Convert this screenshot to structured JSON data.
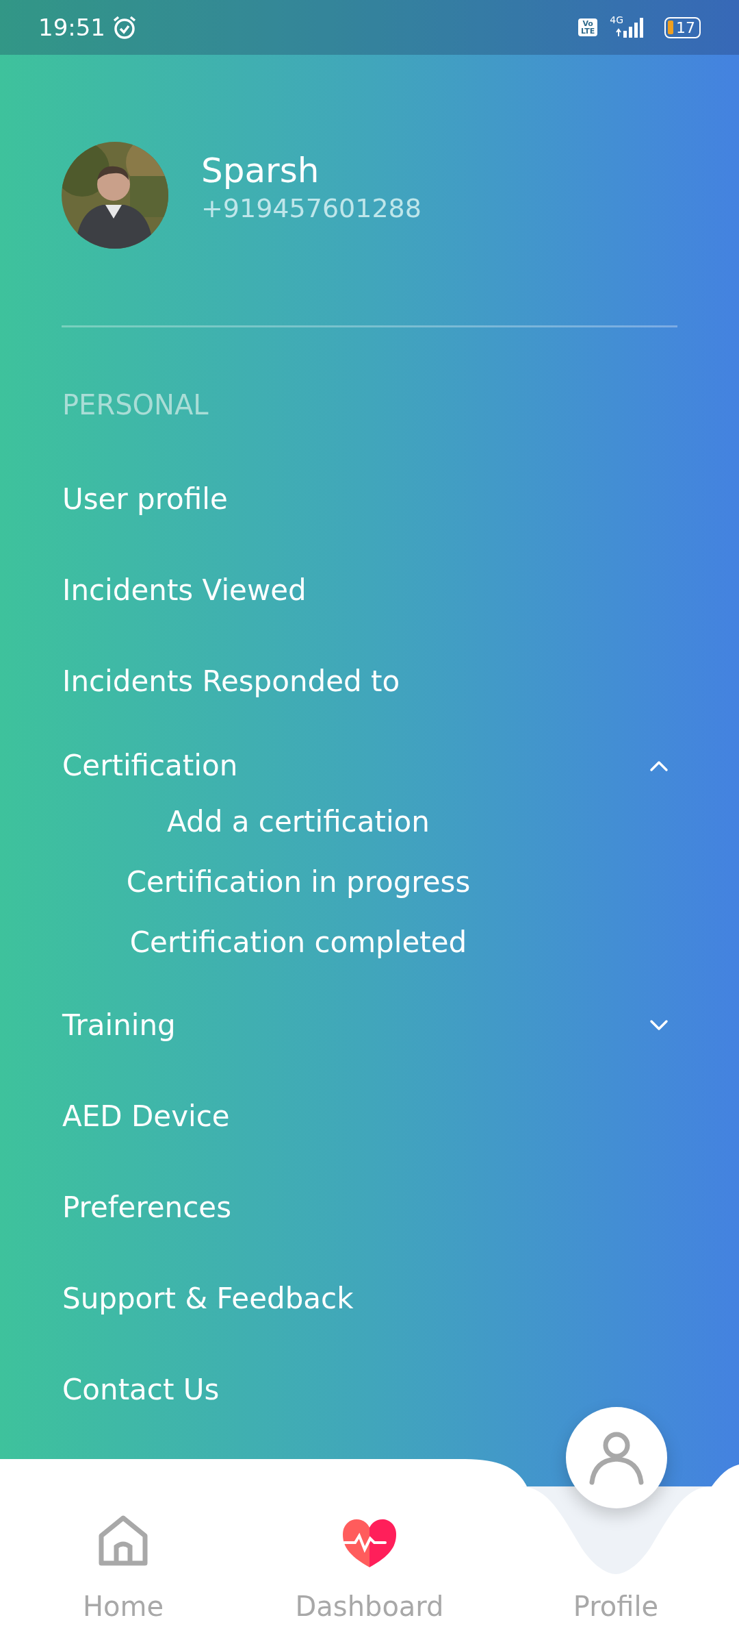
{
  "status_bar": {
    "time": "19:51",
    "volte": [
      "Vo",
      "LTE"
    ],
    "network": "4G",
    "battery": "17"
  },
  "profile": {
    "name": "Sparsh",
    "phone": "+919457601288"
  },
  "section_title": "PERSONAL",
  "menu": [
    {
      "kind": "link",
      "label": "User profile"
    },
    {
      "kind": "link",
      "label": "Incidents Viewed"
    },
    {
      "kind": "link",
      "label": "Incidents Responded to"
    },
    {
      "kind": "group",
      "label": "Certification",
      "expanded": true,
      "children": [
        {
          "label": "Add a certification"
        },
        {
          "label": "Certification in progress"
        },
        {
          "label": "Certification completed"
        }
      ]
    },
    {
      "kind": "group",
      "label": "Training",
      "expanded": false
    },
    {
      "kind": "link",
      "label": "AED Device"
    },
    {
      "kind": "link",
      "label": "Preferences"
    },
    {
      "kind": "link",
      "label": "Support & Feedback"
    },
    {
      "kind": "link",
      "label": "Contact Us"
    }
  ],
  "bottom_nav": [
    {
      "kind": "home",
      "label": "Home",
      "selected": false
    },
    {
      "kind": "dashboard",
      "label": "Dashboard",
      "selected": false
    },
    {
      "kind": "profile",
      "label": "Profile",
      "selected": true
    }
  ]
}
